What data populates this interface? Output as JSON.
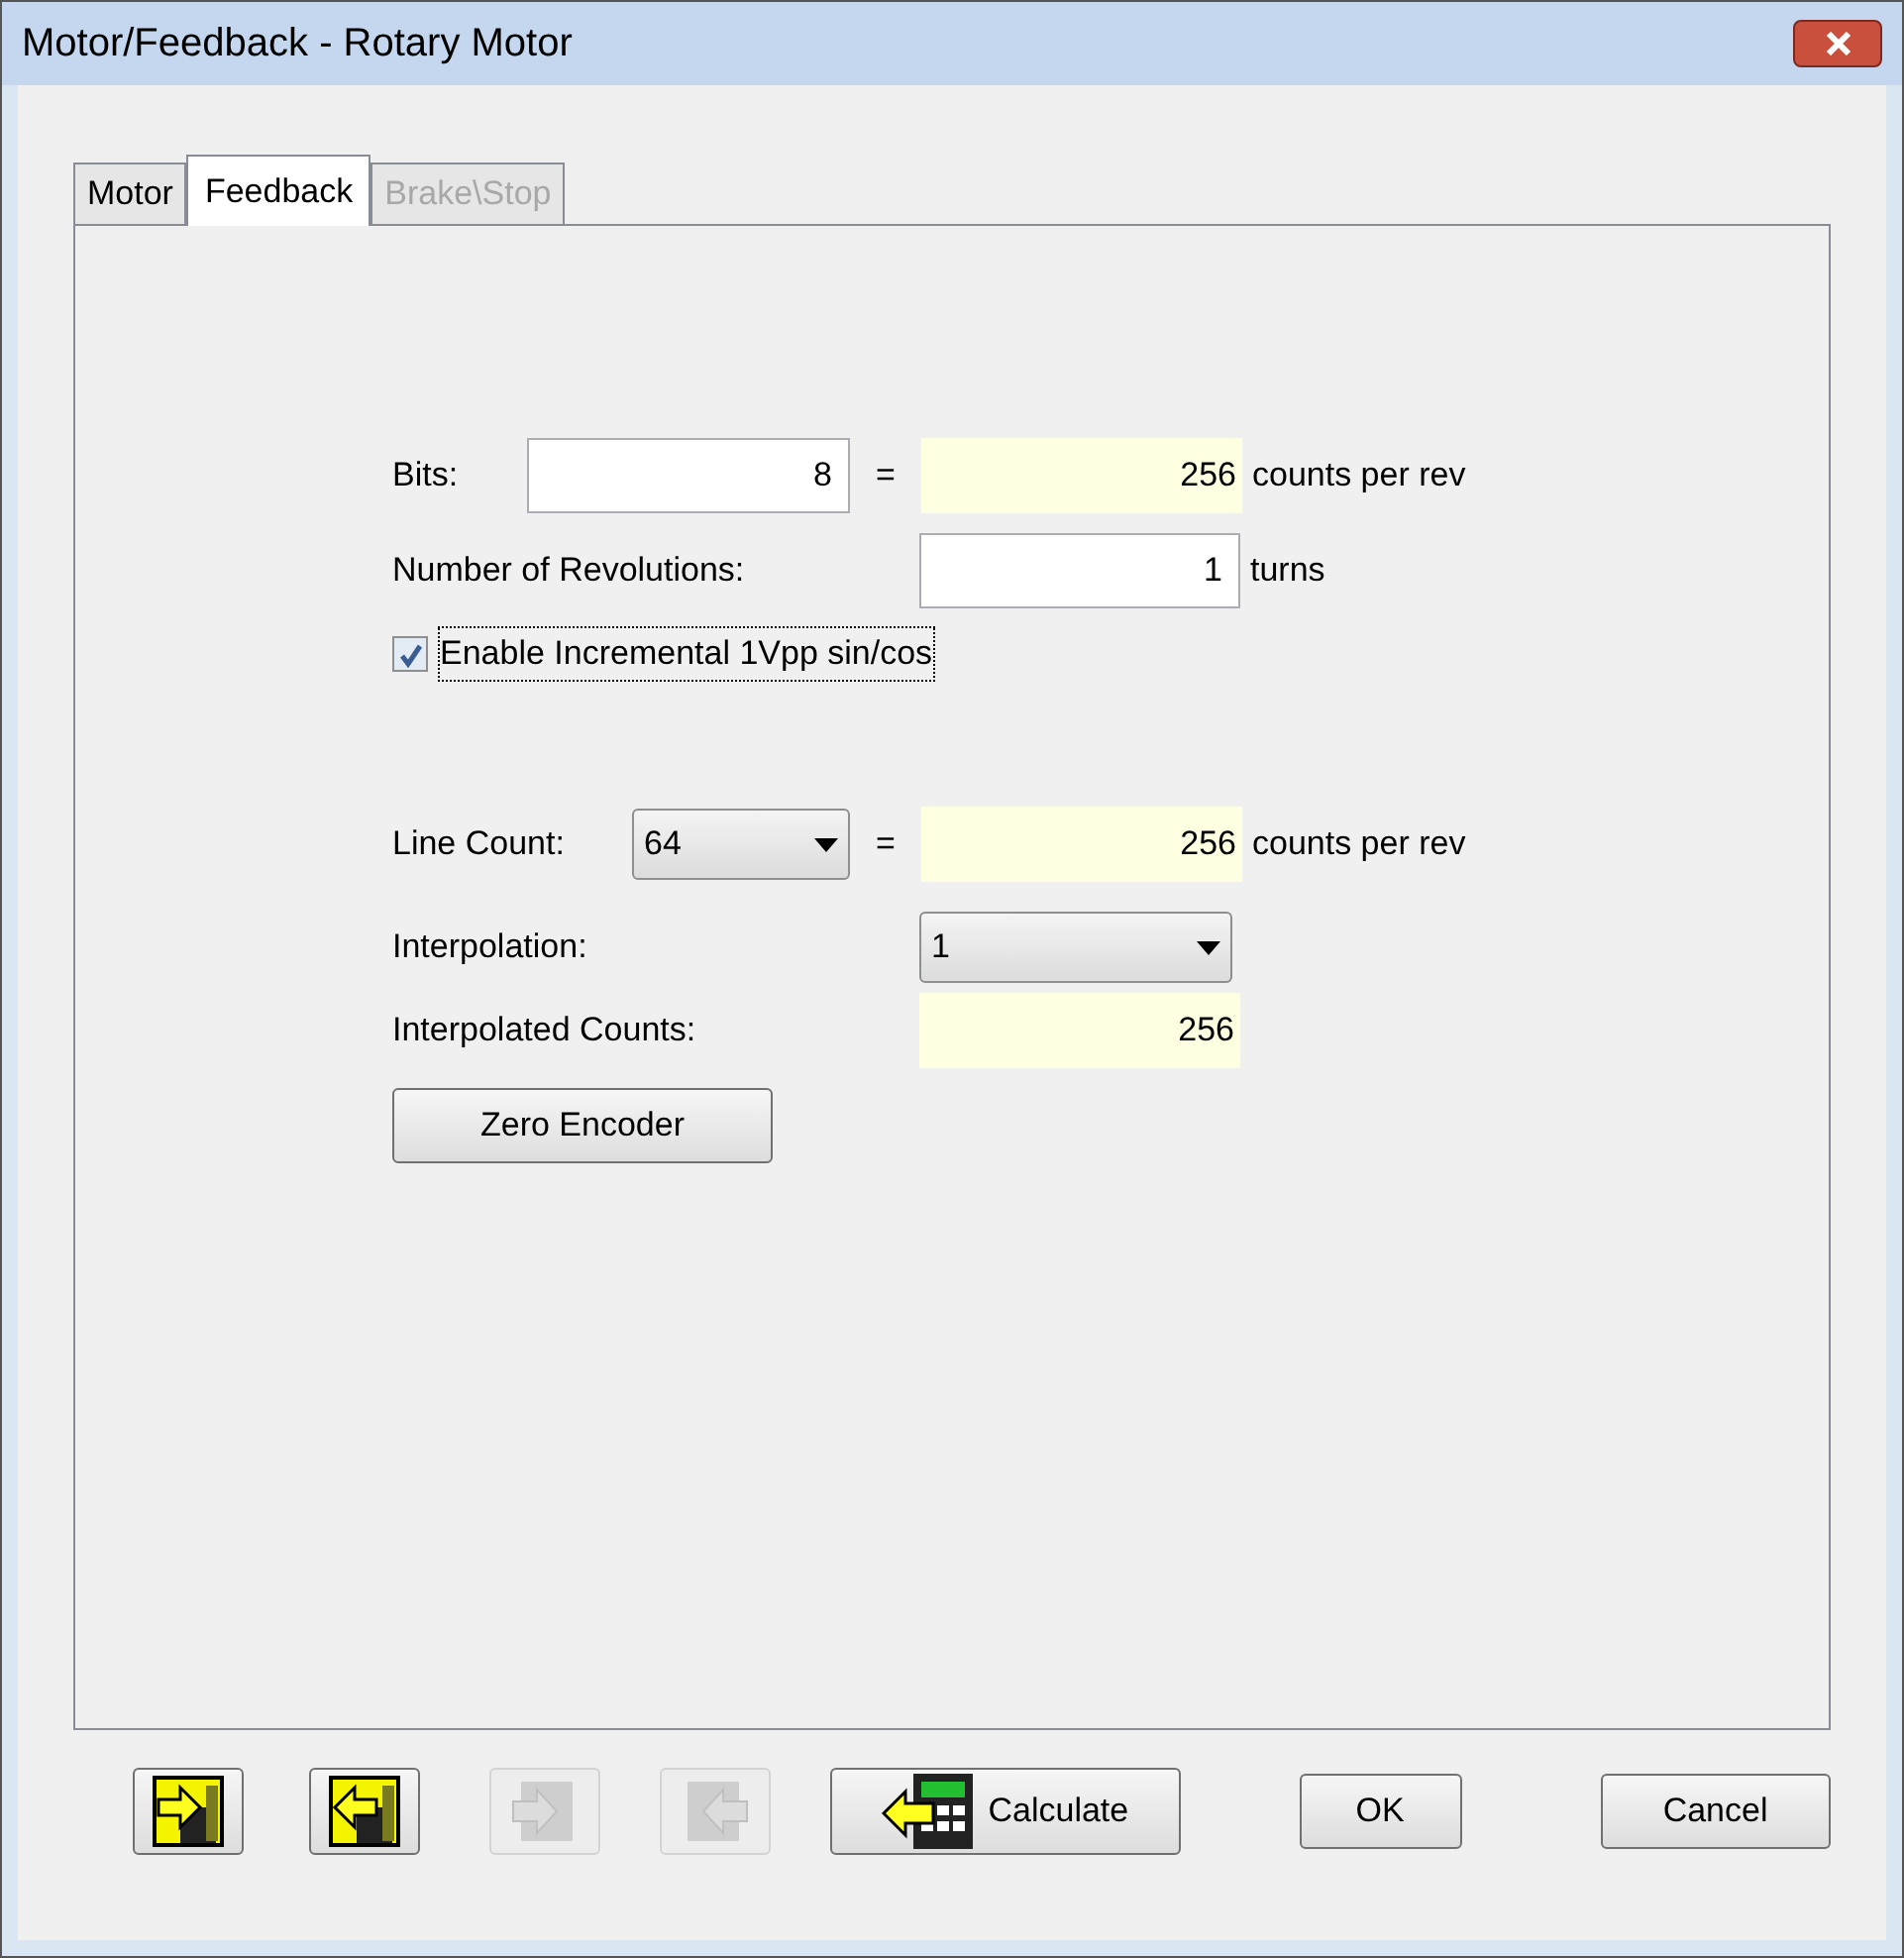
{
  "window": {
    "title": "Motor/Feedback - Rotary Motor"
  },
  "tabs": [
    {
      "label": "Motor",
      "selected": false,
      "disabled": false
    },
    {
      "label": "Feedback",
      "selected": true,
      "disabled": false
    },
    {
      "label": "Brake\\Stop",
      "selected": false,
      "disabled": true
    }
  ],
  "bits": {
    "label": "Bits:",
    "value": "8",
    "equals": "=",
    "result": "256",
    "unit": "counts per rev"
  },
  "revolutions": {
    "label": "Number of Revolutions:",
    "value": "1",
    "unit": "turns"
  },
  "incremental": {
    "label": "Enable Incremental 1Vpp sin/cos",
    "checked": true,
    "focused": true
  },
  "line_count": {
    "label": "Line Count:",
    "value": "64",
    "equals": "=",
    "result": "256",
    "unit": "counts per rev"
  },
  "interpolation": {
    "label": "Interpolation:",
    "value": "1"
  },
  "interpolated_counts": {
    "label": "Interpolated Counts:",
    "result": "256"
  },
  "zero_button": "Zero Encoder",
  "toolbar": [
    {
      "kind": "import",
      "disabled": false
    },
    {
      "kind": "export",
      "disabled": false
    },
    {
      "kind": "chip-in",
      "disabled": true
    },
    {
      "kind": "chip-out",
      "disabled": true
    },
    {
      "kind": "calculate",
      "label": "Calculate",
      "disabled": false
    }
  ],
  "buttons": [
    "OK",
    "Cancel"
  ]
}
